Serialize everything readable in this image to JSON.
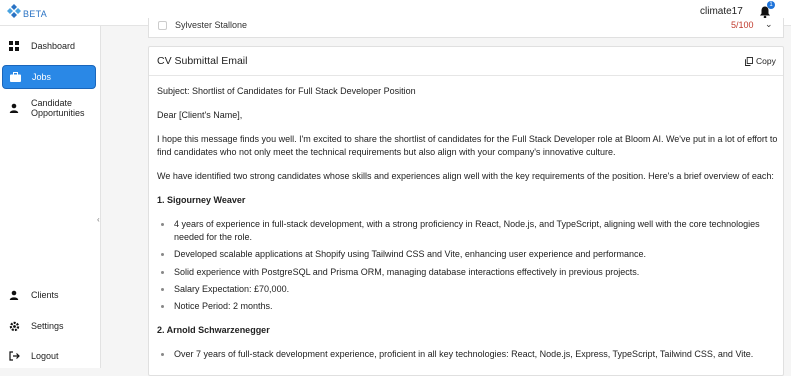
{
  "app": {
    "badge": "BETA"
  },
  "header": {
    "username": "climate17",
    "notifications_count": "1"
  },
  "sidebar": {
    "items": [
      {
        "label": "Dashboard",
        "icon": "grid-icon"
      },
      {
        "label": "Jobs",
        "icon": "briefcase-icon",
        "active": true
      },
      {
        "label_line1": "Candidate",
        "label_line2": "Opportunities",
        "icon": "person-icon"
      },
      {
        "label": "Clients",
        "icon": "person-icon"
      },
      {
        "label": "Settings",
        "icon": "gear-icon"
      },
      {
        "label": "Logout",
        "icon": "logout-icon"
      }
    ],
    "collapse_glyph": "‹"
  },
  "candidate_row": {
    "name": "Sylvester Stallone",
    "score": "5/100",
    "chevron": "⌄"
  },
  "email_card": {
    "title": "CV Submittal Email",
    "copy_label": "Copy",
    "subject": "Subject: Shortlist of Candidates for Full Stack Developer Position",
    "greeting": "Dear [Client's Name],",
    "intro_1": "I hope this message finds you well. I'm excited to share the shortlist of candidates for the Full Stack Developer role at Bloom AI. We've put in a lot of effort to",
    "intro_2": "find candidates who not only meet the technical requirements but also align with your company's innovative culture.",
    "overview": "We have identified two strong candidates whose skills and experiences align well with the key requirements of the position. Here's a brief overview of each:",
    "candidate_1": {
      "heading": "1. Sigourney Weaver",
      "points": [
        "4 years of experience in full-stack development, with a strong proficiency in React, Node.js, and TypeScript, aligning well with the core technologies",
        "needed for the role.",
        "Developed scalable applications at Shopify using Tailwind CSS and Vite, enhancing user experience and performance.",
        "Solid experience with PostgreSQL and Prisma ORM, managing database interactions effectively in previous projects.",
        "Salary Expectation: £70,000.",
        "Notice Period: 2 months."
      ]
    },
    "candidate_2": {
      "heading": "2. Arnold Schwarzenegger",
      "points": [
        "Over 7 years of full-stack development experience, proficient in all key technologies: React, Node.js, Express, TypeScript, Tailwind CSS, and Vite."
      ]
    }
  },
  "colors": {
    "accent": "#2a88e6",
    "score_red": "#c0392b",
    "brand": "#2a73c4"
  }
}
